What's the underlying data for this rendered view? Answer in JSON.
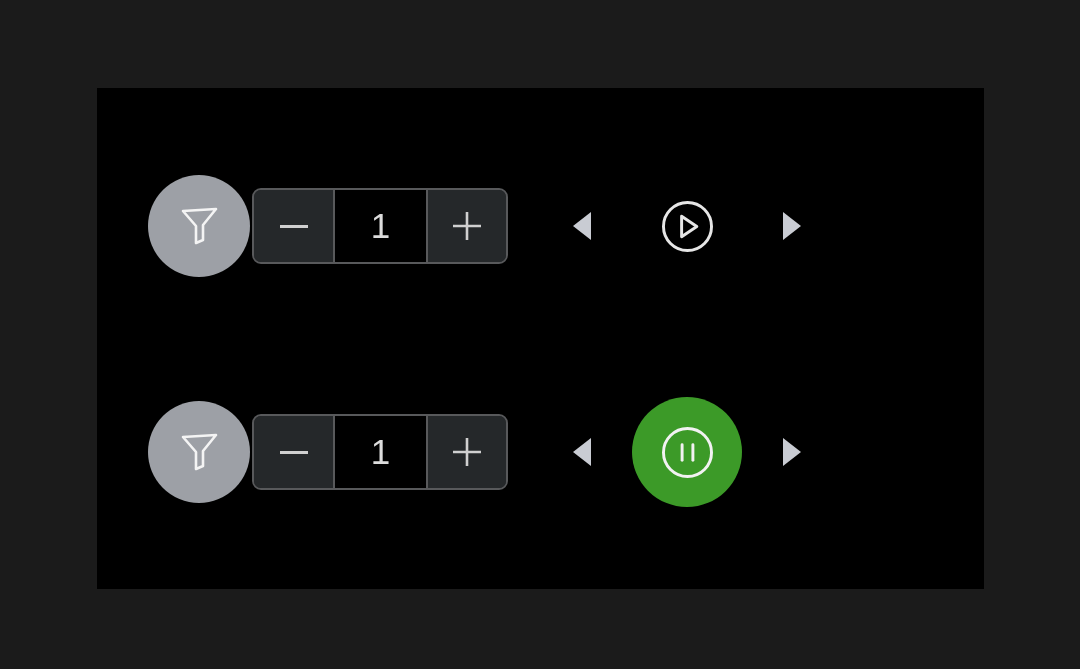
{
  "players": [
    {
      "count": "1",
      "playing": false
    },
    {
      "count": "1",
      "playing": true
    }
  ]
}
